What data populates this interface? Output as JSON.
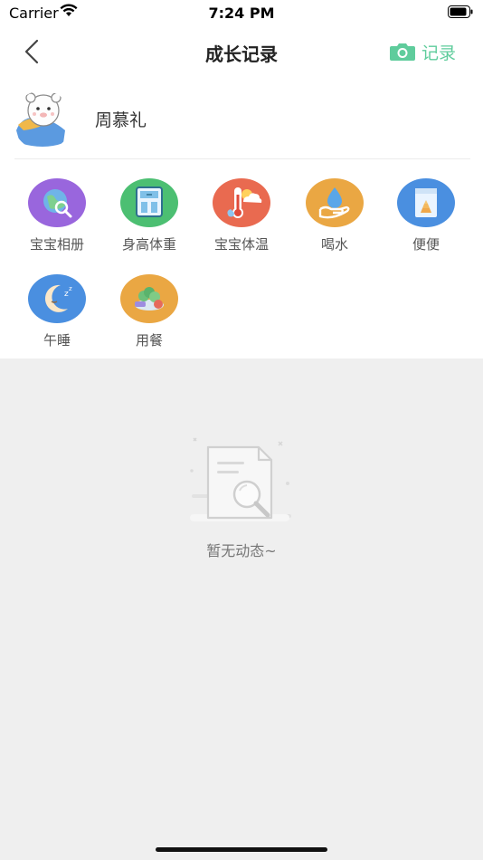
{
  "status_bar": {
    "carrier": "Carrier",
    "time": "7:24 PM"
  },
  "nav": {
    "title": "成长记录",
    "record_label": "记录"
  },
  "profile": {
    "name": "周慕礼"
  },
  "grid": [
    {
      "label": "宝宝相册",
      "icon": "album-icon",
      "color": "#9966dd"
    },
    {
      "label": "身高体重",
      "icon": "scale-icon",
      "color": "#4cbf72"
    },
    {
      "label": "宝宝体温",
      "icon": "thermometer-icon",
      "color": "#e96a50"
    },
    {
      "label": "喝水",
      "icon": "water-drop-icon",
      "color": "#eaa743"
    },
    {
      "label": "便便",
      "icon": "potty-icon",
      "color": "#4a8fe0"
    },
    {
      "label": "午睡",
      "icon": "moon-icon",
      "color": "#4a8fe0"
    },
    {
      "label": "用餐",
      "icon": "meal-icon",
      "color": "#eaa743"
    }
  ],
  "empty_state": {
    "text": "暂无动态~"
  },
  "colors": {
    "accent": "#5fcc9c",
    "background": "#efefef"
  }
}
